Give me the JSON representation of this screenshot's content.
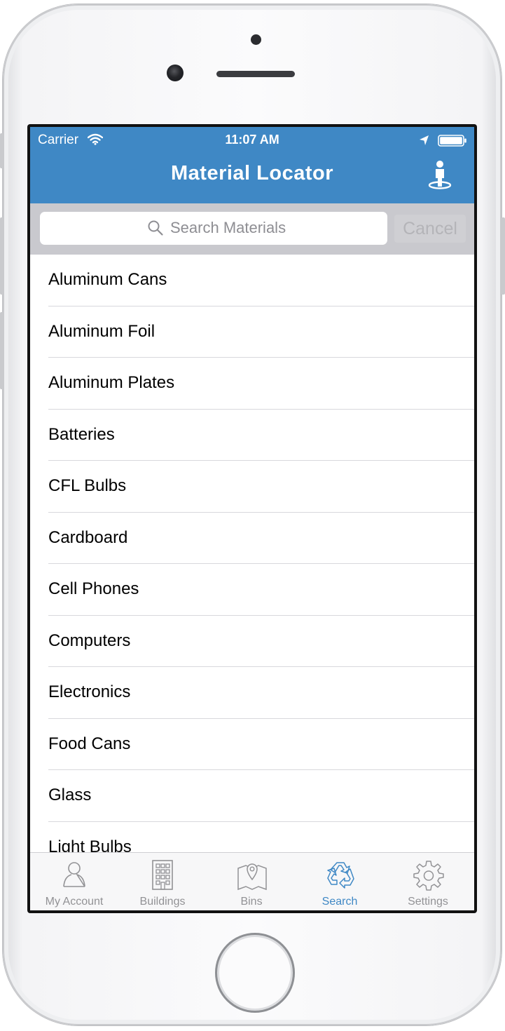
{
  "status_bar": {
    "carrier": "Carrier",
    "time": "11:07 AM"
  },
  "nav": {
    "title": "Material Locator",
    "right_icon": "person-location-icon"
  },
  "search": {
    "placeholder": "Search Materials",
    "value": "",
    "cancel_label": "Cancel"
  },
  "materials": [
    "Aluminum Cans",
    "Aluminum Foil",
    "Aluminum Plates",
    "Batteries",
    "CFL Bulbs",
    "Cardboard",
    "Cell Phones",
    "Computers",
    "Electronics",
    "Food Cans",
    "Glass",
    "Light Bulbs"
  ],
  "tabs": [
    {
      "label": "My Account",
      "icon": "person-icon"
    },
    {
      "label": "Buildings",
      "icon": "building-icon"
    },
    {
      "label": "Bins",
      "icon": "map-pin-icon"
    },
    {
      "label": "Search",
      "icon": "recycle-icon",
      "active": true
    },
    {
      "label": "Settings",
      "icon": "gear-icon"
    }
  ],
  "colors": {
    "accent": "#3f88c5",
    "tab_inactive": "#929295",
    "search_bar_bg": "#c9c9ce"
  }
}
